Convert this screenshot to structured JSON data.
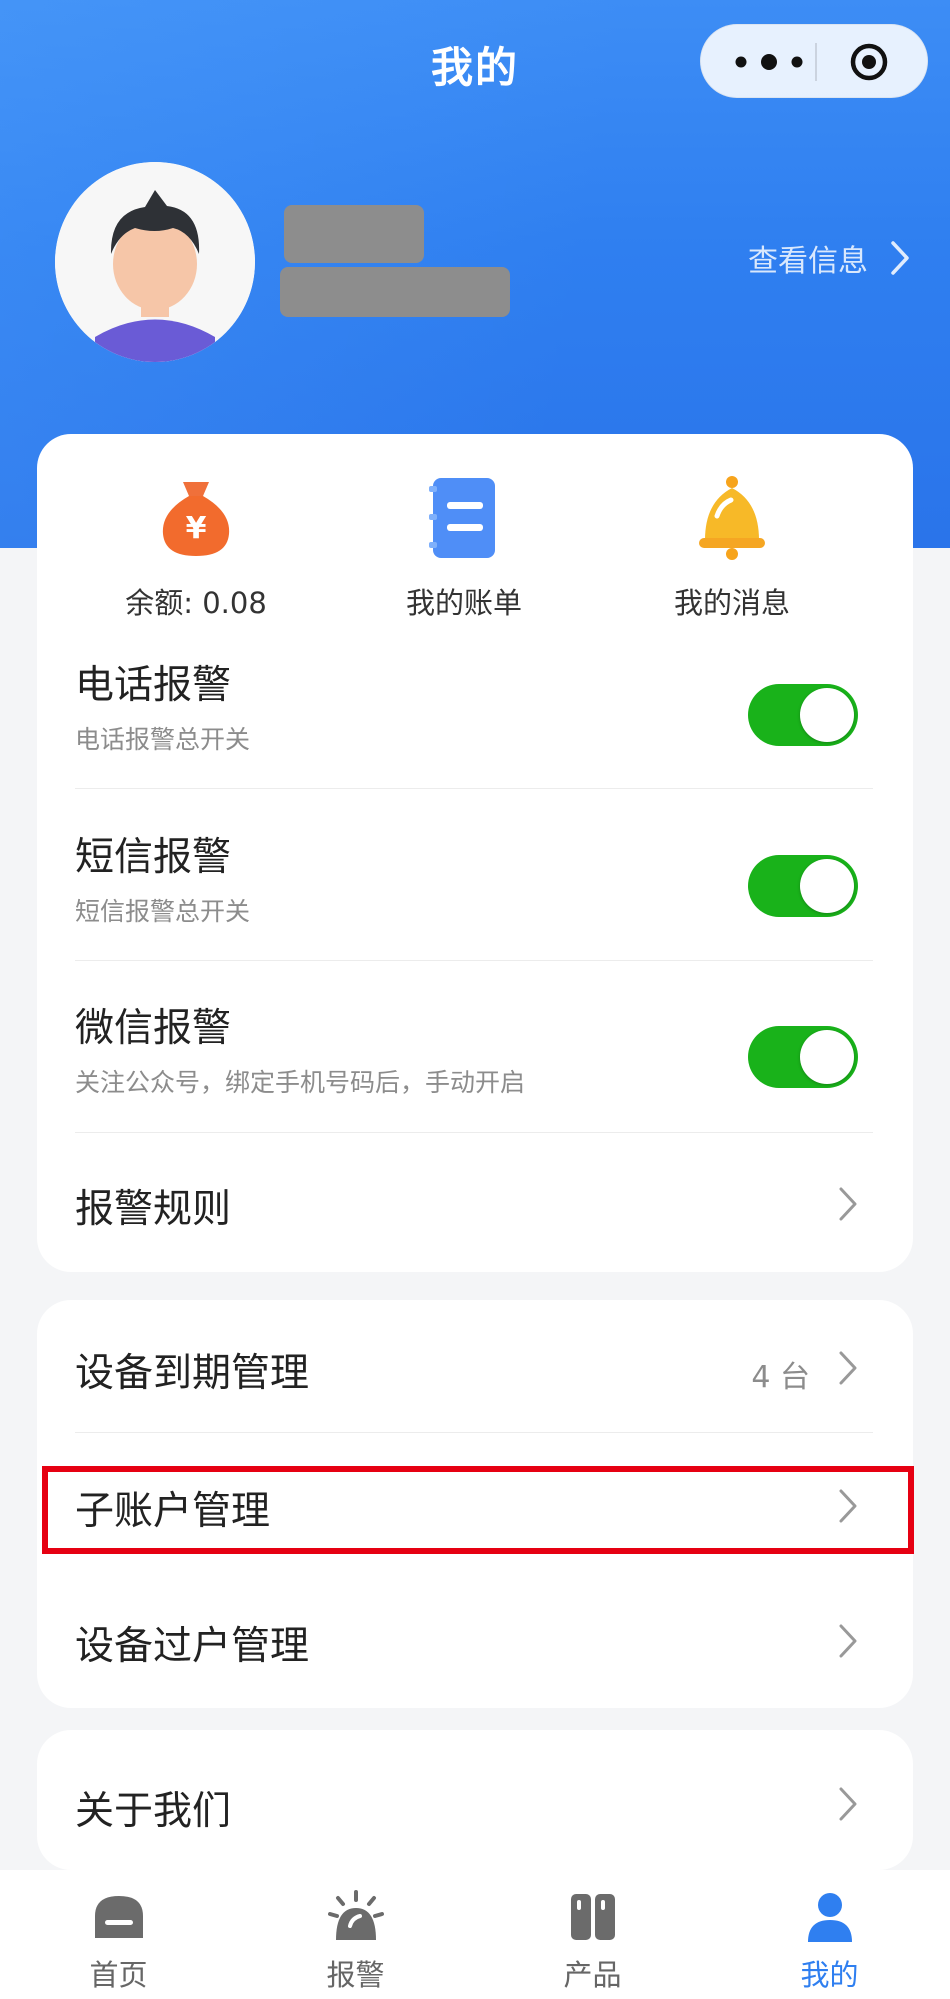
{
  "header": {
    "title": "我的",
    "view_info_label": "查看信息"
  },
  "quick_actions": [
    {
      "label": "余额: 0.08",
      "icon": "money-bag-icon",
      "color": "#f26b2d"
    },
    {
      "label": "我的账单",
      "icon": "bill-notebook-icon",
      "color": "#4f8ef7"
    },
    {
      "label": "我的消息",
      "icon": "bell-icon",
      "color": "#f7b928"
    }
  ],
  "alarm_settings": [
    {
      "title": "电话报警",
      "subtitle": "电话报警总开关",
      "enabled": true
    },
    {
      "title": "短信报警",
      "subtitle": "短信报警总开关",
      "enabled": true
    },
    {
      "title": "微信报警",
      "subtitle": "关注公众号，绑定手机号码后，手动开启",
      "enabled": true
    }
  ],
  "alarm_rules_label": "报警规则",
  "device_menu": [
    {
      "label": "设备到期管理",
      "count": "4 台"
    },
    {
      "label": "子账户管理",
      "count": ""
    },
    {
      "label": "设备过户管理",
      "count": ""
    }
  ],
  "about_label": "关于我们",
  "tabbar": [
    {
      "label": "首页",
      "icon": "home-icon",
      "active": false
    },
    {
      "label": "报警",
      "icon": "alarm-siren-icon",
      "active": false
    },
    {
      "label": "产品",
      "icon": "product-icon",
      "active": false
    },
    {
      "label": "我的",
      "icon": "user-icon",
      "active": true
    }
  ],
  "colors": {
    "header_blue": "#2f7ff0",
    "toggle_green": "#19b21a",
    "highlight_red": "#e60012"
  }
}
